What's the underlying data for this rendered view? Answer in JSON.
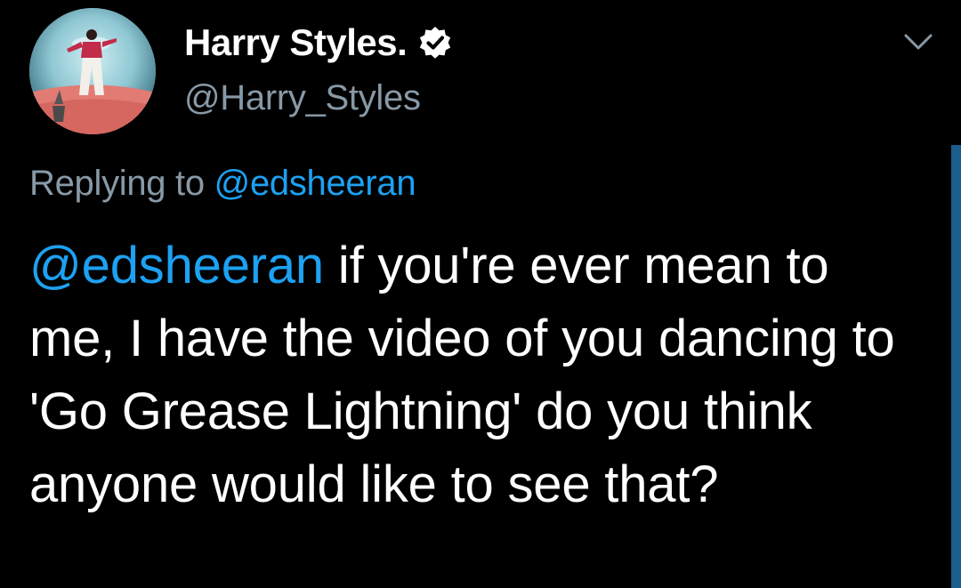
{
  "tweet": {
    "author": {
      "display_name": "Harry Styles.",
      "handle": "@Harry_Styles",
      "verified": true,
      "avatar_icon": "profile-photo"
    },
    "reply_context": {
      "prefix": "Replying to ",
      "mention": "@edsheeran"
    },
    "body": {
      "mention": "@edsheeran",
      "text": " if you're ever mean to me, I have the video of you dancing to 'Go Grease Lightning' do you think anyone would like to see that?"
    },
    "menu_icon": "chevron-down-icon"
  },
  "colors": {
    "background": "#000000",
    "primary_text": "#ffffff",
    "secondary_text": "#8899a6",
    "link": "#1da1f2"
  }
}
